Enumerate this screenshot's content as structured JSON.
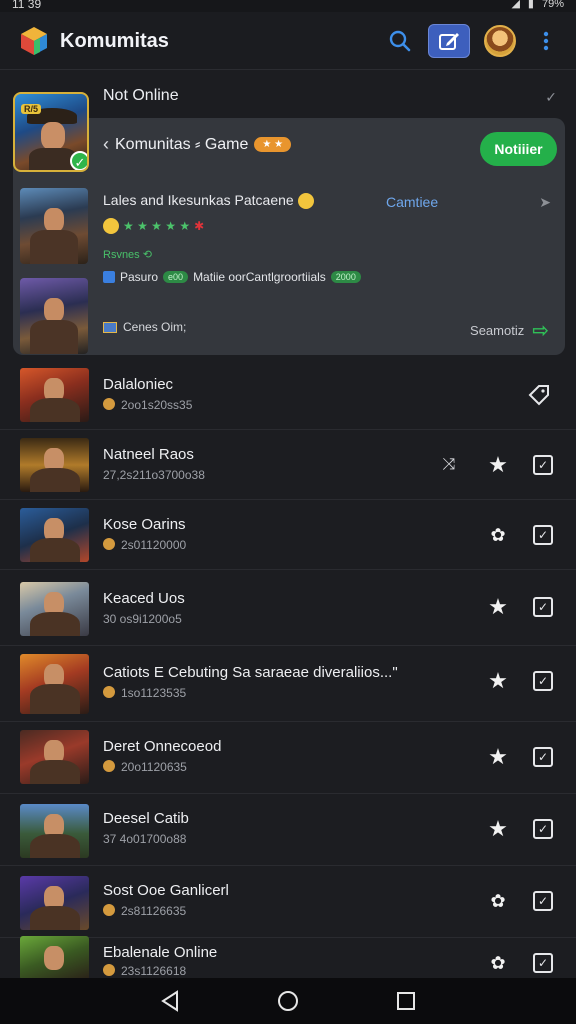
{
  "status_bar": {
    "time": "11 39",
    "battery": "79%"
  },
  "app": {
    "title": "Komumitas"
  },
  "feature": {
    "header_status": "Not Online",
    "card_title": "Komunitas ⸗ Game",
    "card_title_pill": "★ ★",
    "notify_label": "Notiiier",
    "sub_title": "Lales and Ikesunkas Patcaene",
    "sub_link": "Camtiee",
    "rating_text": "★ ★ ★ ★ ★",
    "small_green": "Rsvnes ⟲",
    "info_text_1": "Pasuro",
    "info_tag_1": "e00",
    "info_text_2": "Matiie oorCantlgroortiials",
    "info_tag_2": "2000",
    "doc_text": "Cenes Oim;",
    "search_more": "Seamotiz",
    "corner_tag": "R/5"
  },
  "list": [
    {
      "title": "Dalaloniec",
      "sub": "2oo1s20ss35"
    },
    {
      "title": "Natneel Raos",
      "sub": "27,2s211o3700o38"
    },
    {
      "title": "Kose Oarins",
      "sub": "2s01120000"
    },
    {
      "title": "Keaced Uos",
      "sub": "30 os9i1200o5"
    },
    {
      "title": "Catiots E Cebuting Sa saraeae diveraliios...\"",
      "sub": "1so1123535"
    },
    {
      "title": "Deret Onnecoeod",
      "sub": "20o1120635"
    },
    {
      "title": "Deesel Catib",
      "sub": "37 4o01700o88"
    },
    {
      "title": "Sost Ooe Ganlicerl",
      "sub": "2s81126635"
    },
    {
      "title": "Ebalenale Online",
      "sub": "23s1126618"
    }
  ]
}
